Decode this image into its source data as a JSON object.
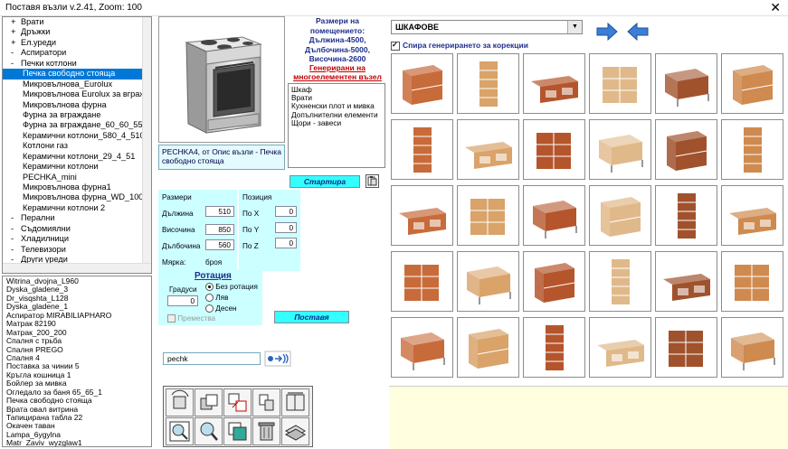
{
  "window": {
    "title": "Поставя възли v.2.41, Zoom:  100",
    "close_glyph": "✕"
  },
  "tree": {
    "items": [
      {
        "sym": "+",
        "label": "Врати",
        "level": 0
      },
      {
        "sym": "+",
        "label": "Дръжки",
        "level": 0
      },
      {
        "sym": "+",
        "label": "Ел.уреди",
        "level": 0
      },
      {
        "sym": "-",
        "label": "Аспиратори",
        "level": 0
      },
      {
        "sym": "-",
        "label": "Печки  котлони",
        "level": 0
      },
      {
        "sym": "",
        "label": "Печка свободно стояща",
        "level": 1,
        "selected": true
      },
      {
        "sym": "",
        "label": "Микровълнова_Eurolux",
        "level": 1
      },
      {
        "sym": "",
        "label": "Микровълнова Eurolux за вграж",
        "level": 1
      },
      {
        "sym": "",
        "label": "Микровълнова фурна",
        "level": 1
      },
      {
        "sym": "",
        "label": "Фурна за вграждане",
        "level": 1
      },
      {
        "sym": "",
        "label": "Фурна за вграждане_60_60_55",
        "level": 1
      },
      {
        "sym": "",
        "label": "Керамични котлони_580_4_510",
        "level": 1
      },
      {
        "sym": "",
        "label": "Котлони газ",
        "level": 1
      },
      {
        "sym": "",
        "label": "Керамични котлони_29_4_51",
        "level": 1
      },
      {
        "sym": "",
        "label": "Керамични котлони",
        "level": 1
      },
      {
        "sym": "",
        "label": "PECHKA_mini",
        "level": 1
      },
      {
        "sym": "",
        "label": "Микровълнова фурна1",
        "level": 1
      },
      {
        "sym": "",
        "label": "Микровълнова фурна_WD_1000",
        "level": 1
      },
      {
        "sym": "",
        "label": "Керамични котлони 2",
        "level": 1
      },
      {
        "sym": "-",
        "label": "Перални",
        "level": 0
      },
      {
        "sym": "-",
        "label": "Съдомиялни",
        "level": 0
      },
      {
        "sym": "-",
        "label": "Хладилници",
        "level": 0
      },
      {
        "sym": "-",
        "label": "Телевизори",
        "level": 0
      },
      {
        "sym": "-",
        "label": "Други уреди",
        "level": 0
      }
    ]
  },
  "history": {
    "items": [
      "Witrina_dvojna_L960",
      "Dyska_gladene_3",
      "Dr_visqshta_L128",
      "Dyska_gladene_1",
      "Аспиратор MIRABILIAPHARO",
      "Матрак 82190",
      "Матрак_200_200",
      "Спалня с трьба",
      "Спалня PREGO",
      "Спалня 4",
      "Поставка за чинии 5",
      "Кръгла кошница 1",
      "Бойлер за мивка",
      "Огледало  за баня 65_65_1",
      "Печка свободно стояща",
      "Врата овал витрина",
      "Тапицирана табла 22",
      "Окачен таван",
      "Lampa_6ygylna",
      "Matr_Zaviv_wyzglaw1"
    ]
  },
  "preview": {
    "description": "PECHKA4, от Опис възли - Печка свободно стояща"
  },
  "room": {
    "line1": "Размери на помещението:",
    "line2": "Дължина-4500,",
    "line3": "Дълбочина-5000,",
    "line4": "Височина-2600"
  },
  "generated": {
    "link_line1": "Генерирани на",
    "link_line2": "многоелементен възел",
    "items": [
      "Шкаф",
      "Врати",
      "Кухненски плот и мивка",
      "Допълнителни елементи",
      "Щори - завеси"
    ]
  },
  "start_button": "Стартира",
  "dims": {
    "title": "Размери",
    "length_label": "Дължина",
    "length": "510",
    "height_label": "Височина",
    "height": "850",
    "depth_label": "Дълбочина",
    "depth": "560",
    "unit_label": "Мярка:",
    "unit": "броя"
  },
  "pos": {
    "title": "Позиция",
    "x_label": "По X",
    "x": "0",
    "y_label": "По Y",
    "y": "0",
    "z_label": "По Z",
    "z": "0"
  },
  "rotation": {
    "title": "Ротация",
    "deg_label": "Градуси",
    "deg": "0",
    "opt_none": "Без ротация",
    "opt_left": "Ляв",
    "opt_right": "Десен",
    "move_label": "Премества"
  },
  "place_button": "Поставя",
  "search": {
    "value": "pechk"
  },
  "category": {
    "selected": "ШКАФОВЕ",
    "stop_label": "Спира генерирането за корекции"
  },
  "colors": {
    "accent": "#0078d7",
    "cyan_panel": "#ccffff",
    "button_cyan": "#33ffff",
    "info_yellow": "#ffffe0",
    "title_blue": "#1c2f8f",
    "link_red": "#c00000"
  }
}
